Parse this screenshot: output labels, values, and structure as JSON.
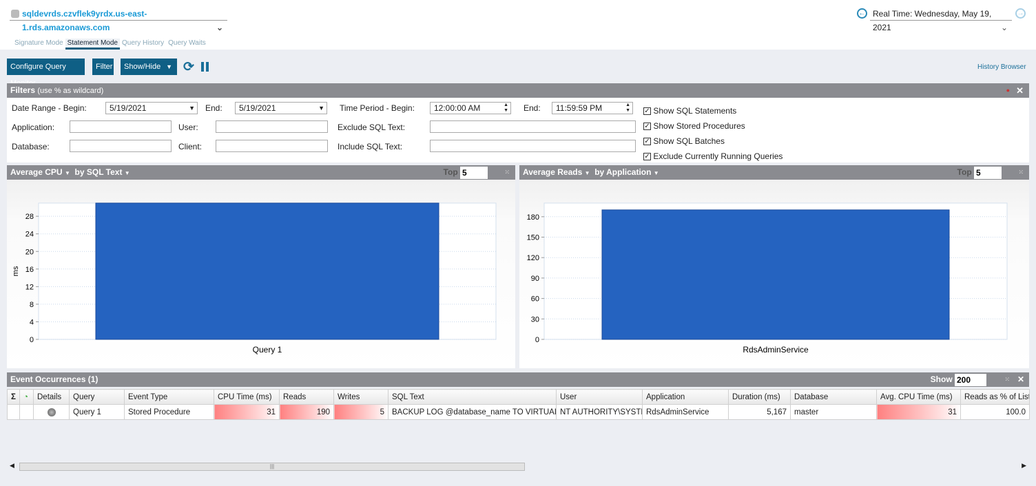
{
  "header": {
    "server": "sqldevrds.czvflek9yrdx.us-east-1.rds.amazonaws.com",
    "realtime": "Real Time: Wednesday, May 19, 2021"
  },
  "tabs": [
    {
      "label": "Signature Mode"
    },
    {
      "label": "Statement Mode"
    },
    {
      "label": "Query History"
    },
    {
      "label": "Query Waits"
    }
  ],
  "toolbar": {
    "configure": "Configure Query Monitor",
    "filter": "Filter",
    "showhide": "Show/Hide",
    "history": "History Browser"
  },
  "filters": {
    "title": "Filters",
    "hint": "(use % as wildcard)",
    "date_begin_label": "Date Range - Begin:",
    "date_begin": "5/19/2021",
    "end_label": "End:",
    "date_end": "5/19/2021",
    "time_begin_label": "Time Period - Begin:",
    "time_begin": "12:00:00 AM",
    "time_end_label": "End:",
    "time_end": "11:59:59 PM",
    "application_label": "Application:",
    "user_label": "User:",
    "exclude_label": "Exclude SQL Text:",
    "database_label": "Database:",
    "client_label": "Client:",
    "include_label": "Include SQL Text:",
    "checks": [
      {
        "label": "Show SQL Statements",
        "checked": true
      },
      {
        "label": "Show Stored Procedures",
        "checked": true
      },
      {
        "label": "Show SQL Batches",
        "checked": true
      },
      {
        "label": "Exclude Currently Running Queries",
        "checked": true
      }
    ]
  },
  "charts": {
    "top_label": "Top"
  },
  "chart_data": [
    {
      "type": "bar",
      "metric": "Average CPU",
      "group": "by SQL Text",
      "top": "5",
      "categories": [
        "Query 1"
      ],
      "values": [
        31
      ],
      "ylabel": "ms",
      "xlabel": "Query 1",
      "ylim": [
        0,
        31
      ],
      "yticks": [
        "0",
        "4",
        "8",
        "12",
        "16",
        "20",
        "24",
        "28"
      ],
      "color": "#2563c0"
    },
    {
      "type": "bar",
      "metric": "Average Reads",
      "group": "by Application",
      "top": "5",
      "categories": [
        "RdsAdminService"
      ],
      "values": [
        190
      ],
      "ylabel": "",
      "xlabel": "RdsAdminService",
      "ylim": [
        0,
        200
      ],
      "yticks": [
        "0",
        "30",
        "60",
        "90",
        "120",
        "150",
        "180"
      ],
      "color": "#2563c0"
    }
  ],
  "events": {
    "title": "Event Occurrences (1)",
    "show_label": "Show",
    "show_value": "200",
    "columns": [
      "Σ",
      "",
      "Details",
      "Query",
      "Event Type",
      "CPU Time (ms)",
      "Reads",
      "Writes",
      "SQL Text",
      "User",
      "Application",
      "Duration (ms)",
      "Database",
      "Avg. CPU Time (ms)",
      "Reads as % of List"
    ],
    "rows": [
      [
        "",
        "",
        "",
        "Query 1",
        "Stored Procedure",
        "31",
        "190",
        "5",
        "BACKUP LOG @database_name TO VIRTUAL_D",
        "NT AUTHORITY\\SYSTE",
        "RdsAdminService",
        "5,167",
        "master",
        "31",
        "100.0"
      ]
    ]
  }
}
